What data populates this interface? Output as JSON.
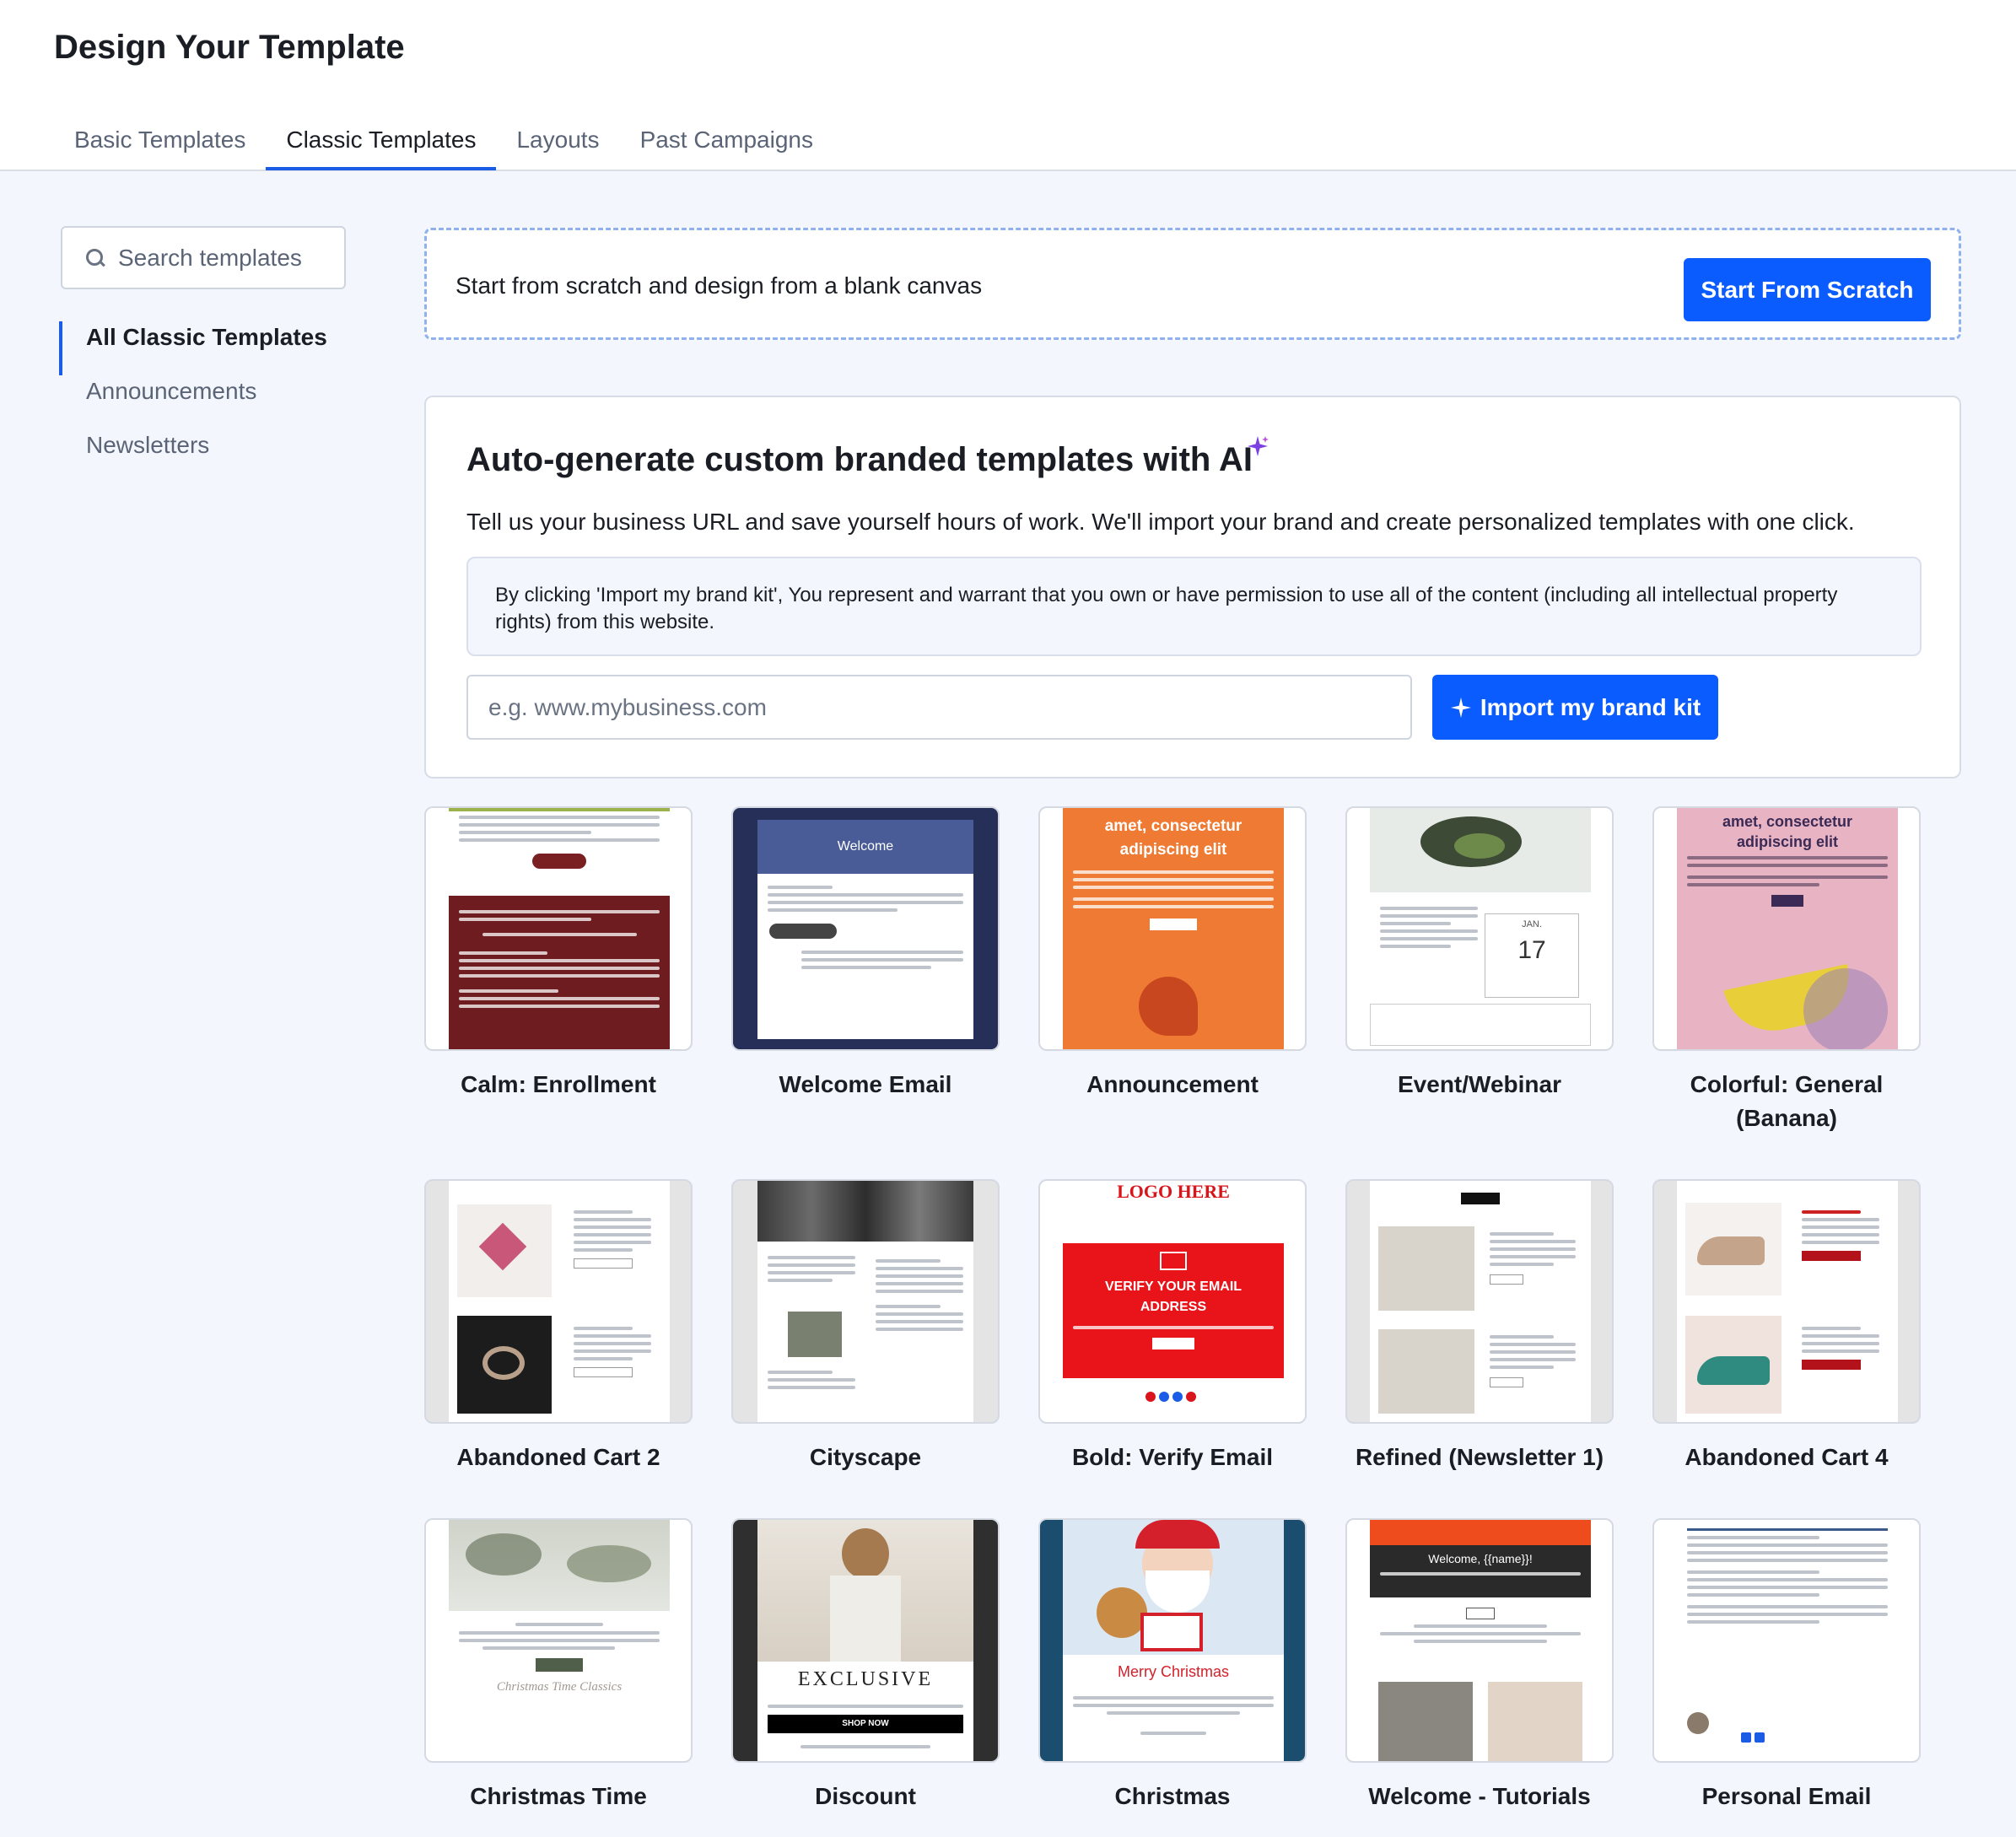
{
  "page_title": "Design Your Template",
  "tabs": [
    "Basic Templates",
    "Classic Templates",
    "Layouts",
    "Past Campaigns"
  ],
  "search": {
    "placeholder": "Search templates"
  },
  "categories": [
    "All Classic Templates",
    "Announcements",
    "Newsletters"
  ],
  "scratch": {
    "text": "Start from scratch and design from a blank canvas",
    "button": "Start From Scratch"
  },
  "ai": {
    "title": "Auto-generate custom branded templates with AI",
    "subtitle": "Tell us your business URL and save yourself hours of work. We'll import your brand and create personalized templates with one click.",
    "disclaimer": "By clicking 'Import my brand kit', You represent and warrant that you own or have permission to use all of the content (including all intellectual property rights) from this website.",
    "url_placeholder": "e.g. www.mybusiness.com",
    "button": "Import my brand kit"
  },
  "templates": [
    "Calm: Enrollment",
    "Welcome Email",
    "Announcement",
    "Event/Webinar",
    "Colorful: General (Banana)",
    "Abandoned Cart 2",
    "Cityscape",
    "Bold: Verify Email",
    "Refined (Newsletter 1)",
    "Abandoned Cart 4",
    "Christmas Time",
    "Discount",
    "Christmas",
    "Welcome - Tutorials",
    "Personal Email"
  ],
  "thumb_text": {
    "welcome_header": "Welcome",
    "announcement_head": "amet, consectetur adipiscing elit",
    "event_month": "JAN.",
    "event_day": "17",
    "banana_head": "amet, consectetur adipiscing elit",
    "verify_logo": "LOGO HERE",
    "verify_text": "VERIFY YOUR EMAIL ADDRESS",
    "exclusive": "EXCLUSIVE",
    "shop_now": "SHOP NOW",
    "merry": "Merry Christmas",
    "tutorial_welcome": "Welcome, {{name}}!",
    "xmas_script": "Christmas Time Classics"
  },
  "colors": {
    "accent": "#0b5cff",
    "tab_underline": "#1a5ce6"
  }
}
